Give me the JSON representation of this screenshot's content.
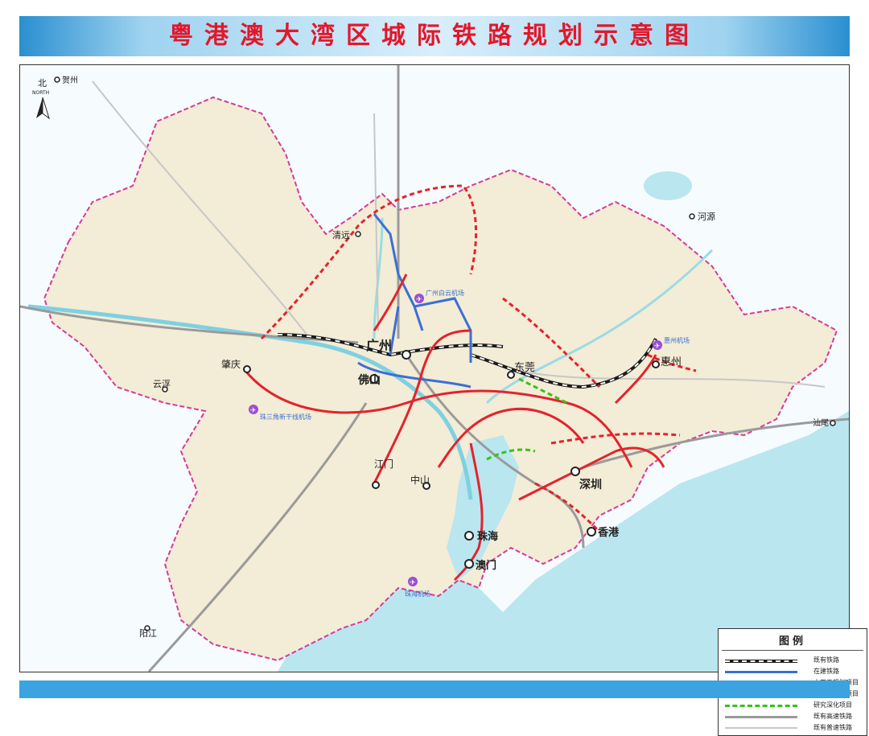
{
  "title": "粤港澳大湾区城际铁路规划示意图",
  "north": {
    "label": "北",
    "sub": "NORTH"
  },
  "colors": {
    "existing_rail": "#1a1a1a",
    "under_construction": "#3b6fd4",
    "plan_14th": "#e3232c",
    "plan_long_term": "#e3232c",
    "research": "#36c21a",
    "existing_hsr": "#9a9a9a",
    "existing_normal": "#c7c7c7",
    "boundary": "#d63a9a",
    "land_in": "#f3ecd6",
    "water": "#b9e6ef"
  },
  "cities": {
    "guangzhou": "广州",
    "foshan": "佛山",
    "shenzhen": "深圳",
    "dongguan": "东莞",
    "huizhou": "惠州",
    "zhaoqing": "肇庆",
    "jiangmen": "江门",
    "zhongshan": "中山",
    "zhuhai": "珠海",
    "macau": "澳门",
    "hongkong": "香港",
    "qingyuan": "清远",
    "yunfu": "云浮",
    "heyuan": "河源",
    "shanwei": "汕尾",
    "yangjiang": "阳江",
    "hezhou": "贺州"
  },
  "airports": {
    "zhuhai_airport": "珠海机场",
    "zhaoqing_airport": "珠三角新干线机场",
    "baiyun_airport": "广州白云机场",
    "huizhou_airport": "惠州机场"
  },
  "legend": {
    "title": "图例",
    "items": [
      {
        "label": "既有铁路",
        "style": "existing_rail"
      },
      {
        "label": "在建铁路",
        "style": "under_construction"
      },
      {
        "label": "十四五规划项目",
        "style": "plan_14th"
      },
      {
        "label": "中长期规划项目",
        "style": "plan_long_term"
      },
      {
        "label": "研究深化项目",
        "style": "research"
      },
      {
        "label": "既有高速铁路",
        "style": "existing_hsr"
      },
      {
        "label": "既有普速铁路",
        "style": "existing_normal"
      }
    ]
  }
}
